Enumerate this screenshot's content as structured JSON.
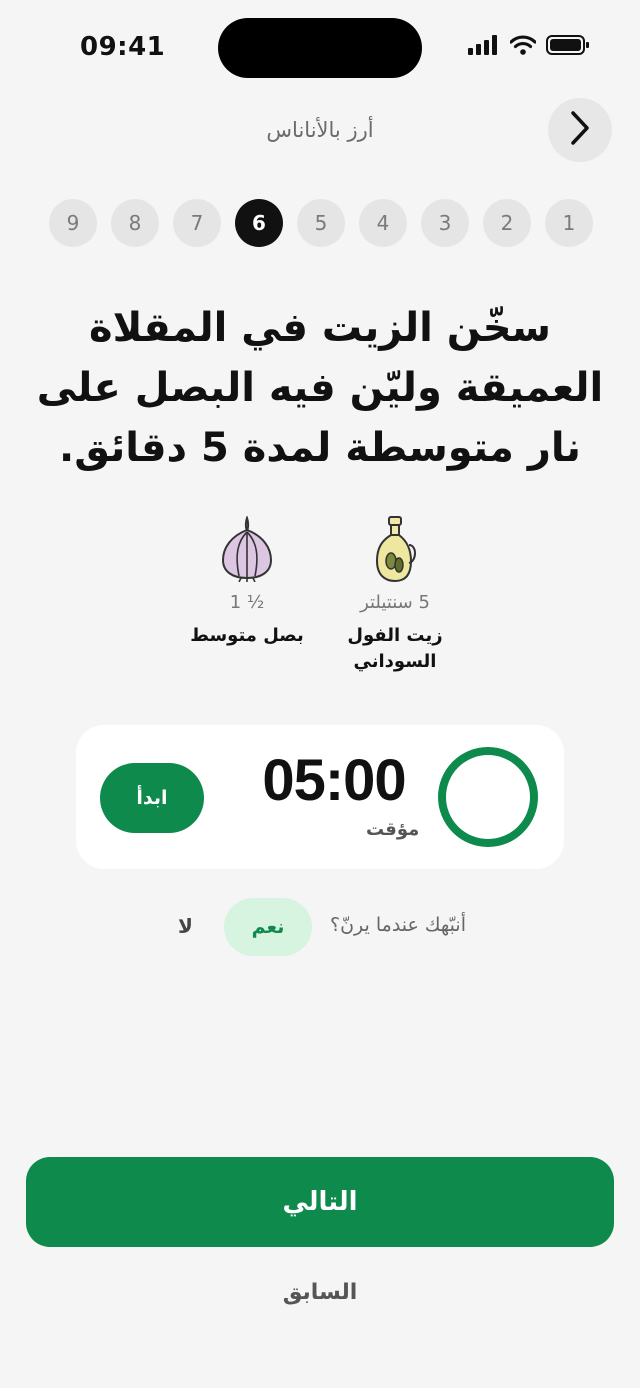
{
  "status_bar": {
    "time": "09:41"
  },
  "header": {
    "title": "أرز بالأناناس",
    "back_icon": "chevron-right-icon"
  },
  "steps": {
    "items": [
      "1",
      "2",
      "3",
      "4",
      "5",
      "6",
      "7",
      "8",
      "9"
    ],
    "active": "6"
  },
  "instruction": {
    "text": "سخّن الزيت في المقلاة العميقة وليّن فيه البصل على نار متوسطة لمدة 5 دقائق."
  },
  "ingredients": [
    {
      "icon": "oil-bottle-icon",
      "amount": "5 سنتيلتر",
      "name": "زيت الفول السوداني"
    },
    {
      "icon": "onion-icon",
      "amount": "½ 1",
      "name": "بصل متوسط"
    }
  ],
  "timer": {
    "value": "05:00",
    "label": "مؤقت",
    "start_label": "ابدأ",
    "ring_color": "#0e8a4c"
  },
  "notify": {
    "question": "أنبّهك عندما يرنّ؟",
    "yes_label": "نعم",
    "no_label": "لا"
  },
  "actions": {
    "next_label": "التالي",
    "previous_label": "السابق"
  },
  "colors": {
    "accent": "#0e8a4c",
    "accent_light": "#d6f4e0",
    "background": "#f5f5f5"
  }
}
